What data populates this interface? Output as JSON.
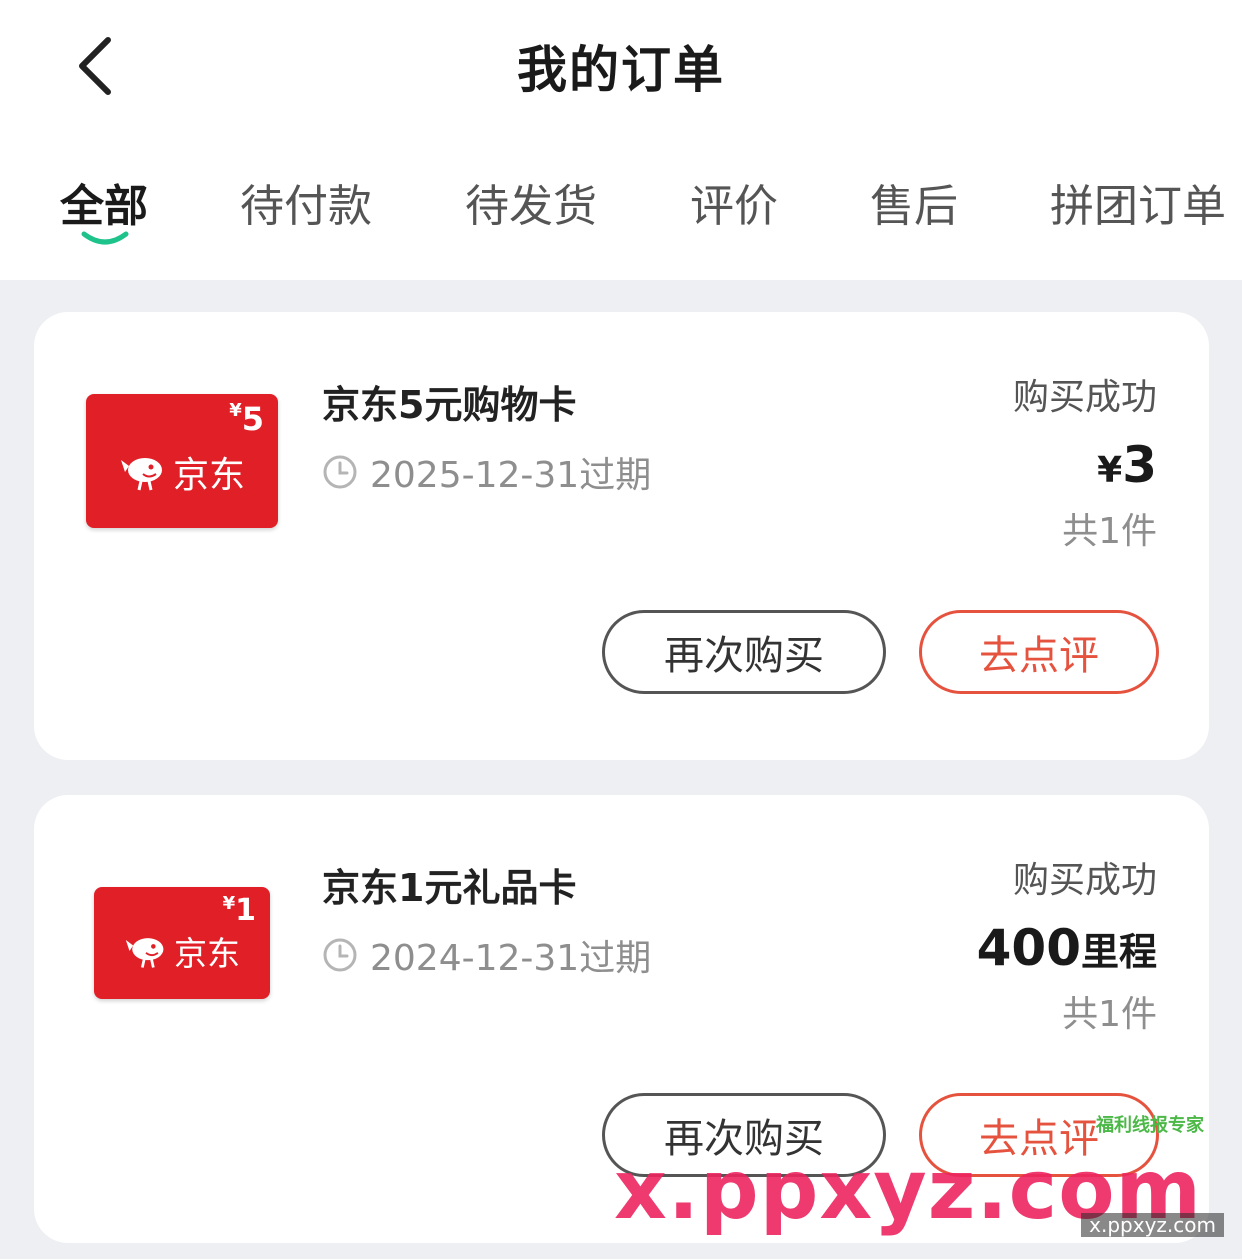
{
  "header": {
    "title": "我的订单",
    "back_icon": "chevron-left-icon"
  },
  "tabs": [
    {
      "label": "全部",
      "active": true
    },
    {
      "label": "待付款",
      "active": false
    },
    {
      "label": "待发货",
      "active": false
    },
    {
      "label": "评价",
      "active": false
    },
    {
      "label": "售后",
      "active": false
    },
    {
      "label": "拼团订单",
      "active": false
    }
  ],
  "colors": {
    "accent_green": "#1ec28b",
    "review_red": "#e5533f",
    "card_red": "#e11f27",
    "background": "#eeeff3"
  },
  "orders": [
    {
      "name": "京东5元购物卡",
      "expiry": "2025-12-31过期",
      "status": "购买成功",
      "price_symbol": "¥",
      "price_value": "3",
      "price_unit": "",
      "count": "共1件",
      "thumb_brand": "京东",
      "thumb_denom_symbol": "¥",
      "thumb_denom_value": "5",
      "rebuy_label": "再次购买",
      "review_label": "去点评"
    },
    {
      "name": "京东1元礼品卡",
      "expiry": "2024-12-31过期",
      "status": "购买成功",
      "price_symbol": "",
      "price_value": "400",
      "price_unit": "里程",
      "count": "共1件",
      "thumb_brand": "京东",
      "thumb_denom_symbol": "¥",
      "thumb_denom_value": "1",
      "rebuy_label": "再次购买",
      "review_label": "去点评"
    }
  ],
  "watermark": {
    "main": "x.ppxyz.com",
    "sub": "x.ppxyz.com",
    "tag": "福利线报专家"
  }
}
